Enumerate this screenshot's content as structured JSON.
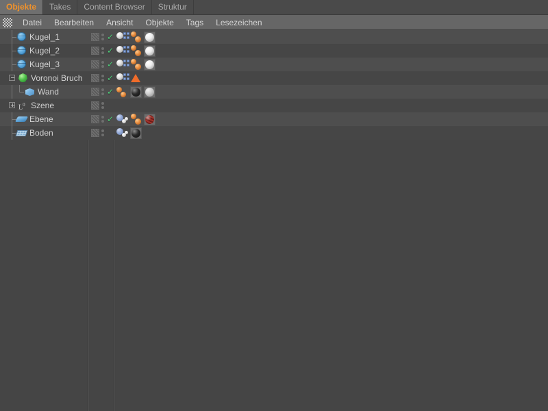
{
  "window": {
    "title": "Objekte",
    "accent_color": "#f0922b",
    "panel_bg": "#454545",
    "row_light": "#4e4e4e",
    "row_dark": "#464646"
  },
  "tabs": [
    {
      "label": "Objekte",
      "active": true
    },
    {
      "label": "Takes",
      "active": false
    },
    {
      "label": "Content Browser",
      "active": false
    },
    {
      "label": "Struktur",
      "active": false
    }
  ],
  "menubar": {
    "handle_icon": "hatch-handle-icon",
    "items": [
      {
        "label": "Datei"
      },
      {
        "label": "Bearbeiten"
      },
      {
        "label": "Ansicht"
      },
      {
        "label": "Objekte"
      },
      {
        "label": "Tags"
      },
      {
        "label": "Lesezeichen"
      }
    ]
  },
  "object_tree": {
    "rows": [
      {
        "name": "Kugel_1",
        "icon": "sphere-icon",
        "depth": 1,
        "expander": "none",
        "tree_branch": true,
        "visible_check": true,
        "tags": [
          "dynamics-body-tag",
          "rigid-body-tag",
          "material-white-tag"
        ]
      },
      {
        "name": "Kugel_2",
        "icon": "sphere-icon",
        "depth": 1,
        "expander": "none",
        "tree_branch": true,
        "visible_check": true,
        "tags": [
          "dynamics-body-tag",
          "rigid-body-tag",
          "material-white-tag"
        ]
      },
      {
        "name": "Kugel_3",
        "icon": "sphere-icon",
        "depth": 1,
        "expander": "none",
        "tree_branch": true,
        "visible_check": true,
        "tags": [
          "dynamics-body-tag",
          "rigid-body-tag",
          "material-white-tag"
        ]
      },
      {
        "name": "Voronoi Bruch",
        "icon": "voronoi-fracture-icon",
        "depth": 0,
        "expander": "minus",
        "tree_branch": false,
        "visible_check": true,
        "tags": [
          "dynamics-body-tag",
          "simulation-triangle-tag"
        ]
      },
      {
        "name": "Wand",
        "icon": "cube-icon",
        "depth": 2,
        "expander": "none",
        "tree_branch": true,
        "visible_check": true,
        "tags": [
          "collider-body-tag",
          "material-black-tag",
          "material-gray-tag"
        ]
      },
      {
        "name": "Szene",
        "icon": "scene-layer-icon",
        "depth": 0,
        "expander": "plus",
        "tree_branch": false,
        "visible_check": false,
        "tags": []
      },
      {
        "name": "Ebene",
        "icon": "plane-icon",
        "depth": 1,
        "expander": "none",
        "tree_branch": true,
        "visible_check": true,
        "tags": [
          "dynamics-collider-tag",
          "rigid-body-tag",
          "material-red-tag"
        ]
      },
      {
        "name": "Boden",
        "icon": "floor-grid-icon",
        "depth": 1,
        "expander": "none",
        "tree_branch": true,
        "visible_check": false,
        "tags": [
          "dynamics-collider-tag",
          "material-black-tag"
        ]
      }
    ]
  }
}
